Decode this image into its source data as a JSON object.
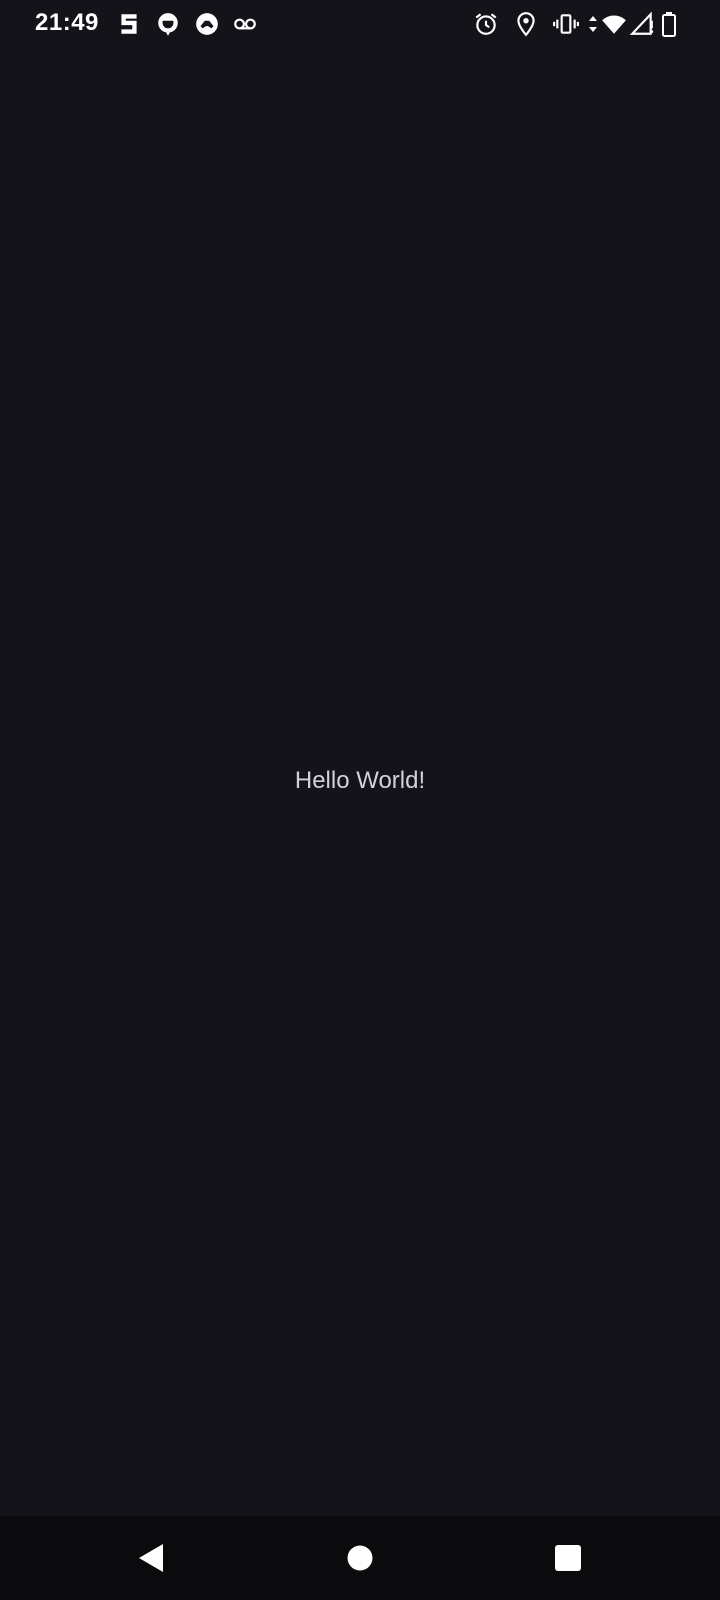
{
  "status_bar": {
    "time": "21:49",
    "left_icons": [
      "signal-app-icon",
      "notification-app-icon",
      "game-controller-icon",
      "voicemail-icon"
    ],
    "right_icons": [
      "alarm-icon",
      "location-icon",
      "vibrate-icon",
      "data-arrows-icon",
      "wifi-icon",
      "cell-signal-no-service-icon",
      "battery-icon"
    ]
  },
  "main": {
    "text": "Hello World!"
  },
  "nav_bar": {
    "buttons": [
      "back-button",
      "home-button",
      "recents-button"
    ]
  },
  "colors": {
    "background": "#15131a",
    "text": "#d2d0d8",
    "nav_background": "#0b0b0d",
    "icon": "#ffffff"
  }
}
